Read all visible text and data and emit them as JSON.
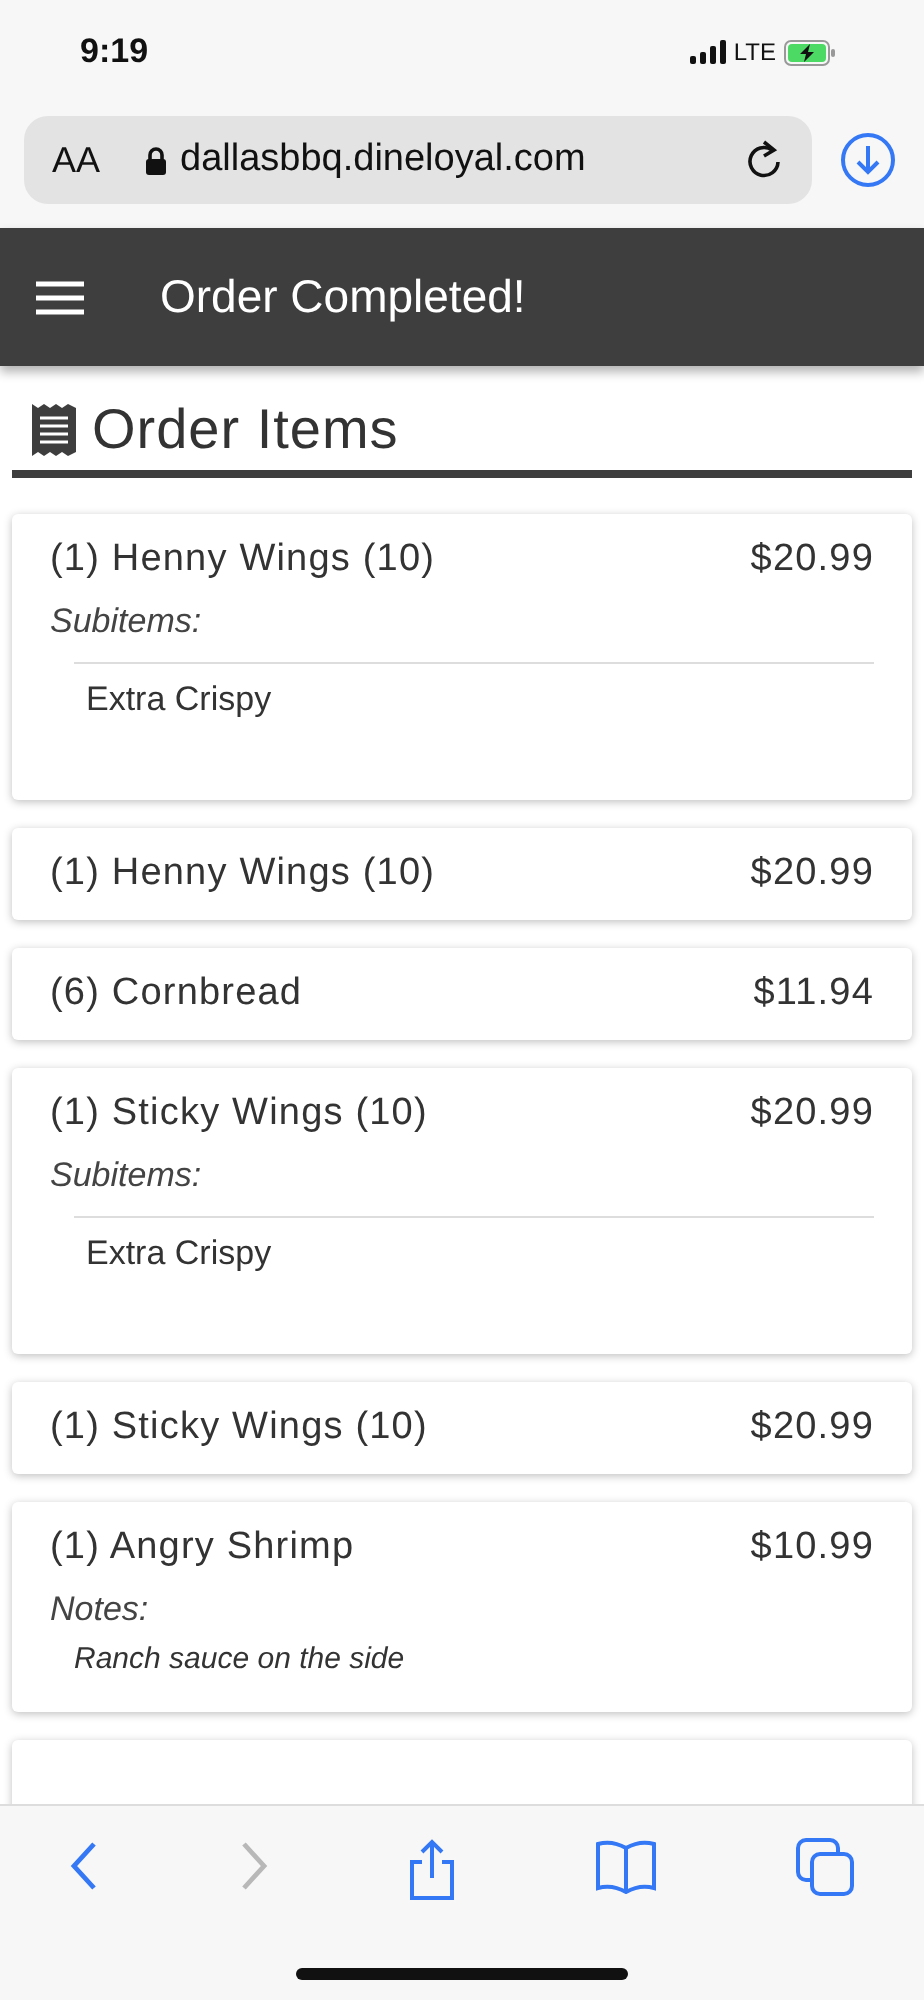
{
  "status_bar": {
    "time": "9:19",
    "network": "LTE"
  },
  "address_bar": {
    "text_size": "AA",
    "url": "dallasbbq.dineloyal.com"
  },
  "header": {
    "title": "Order Completed!"
  },
  "section": {
    "title": "Order Items"
  },
  "items": [
    {
      "name": "(1) Henny Wings (10)",
      "price": "$20.99",
      "details": {
        "kind": "subitems",
        "label": "Subitems:",
        "lines": [
          "Extra Crispy"
        ]
      }
    },
    {
      "name": "(1) Henny Wings (10)",
      "price": "$20.99"
    },
    {
      "name": "(6) Cornbread",
      "price": "$11.94"
    },
    {
      "name": "(1) Sticky Wings (10)",
      "price": "$20.99",
      "details": {
        "kind": "subitems",
        "label": "Subitems:",
        "lines": [
          "Extra Crispy"
        ]
      }
    },
    {
      "name": "(1) Sticky Wings (10)",
      "price": "$20.99"
    },
    {
      "name": "(1) Angry Shrimp",
      "price": "$10.99",
      "details": {
        "kind": "notes",
        "label": "Notes:",
        "lines": [
          "Ranch sauce on the side"
        ]
      }
    }
  ],
  "toolbar": {
    "back_disabled": false,
    "forward_disabled": true
  }
}
